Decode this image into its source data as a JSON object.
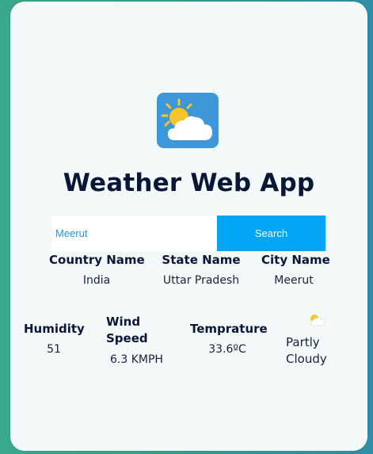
{
  "app": {
    "title": "Weather Web App",
    "logo_icon": "sun-behind-cloud-icon"
  },
  "search": {
    "value": "Meerut",
    "button_label": "Search"
  },
  "location": {
    "country_label": "Country Name",
    "country_value": "India",
    "state_label": "State Name",
    "state_value": "Uttar Pradesh",
    "city_label": "City Name",
    "city_value": "Meerut"
  },
  "weather": {
    "humidity_label": "Humidity",
    "humidity_value": "51",
    "wind_label": "Wind Speed",
    "wind_value": "6.3 KMPH",
    "temperature_label": "Temprature",
    "temperature_value": "33.6ºC",
    "condition_icon": "partly-cloudy-icon",
    "condition_text": "Partly Cloudy"
  },
  "colors": {
    "accent": "#04a5f5",
    "title": "#0b1737",
    "logo_bg": "#3d97d8",
    "sun": "#f7c52b"
  }
}
